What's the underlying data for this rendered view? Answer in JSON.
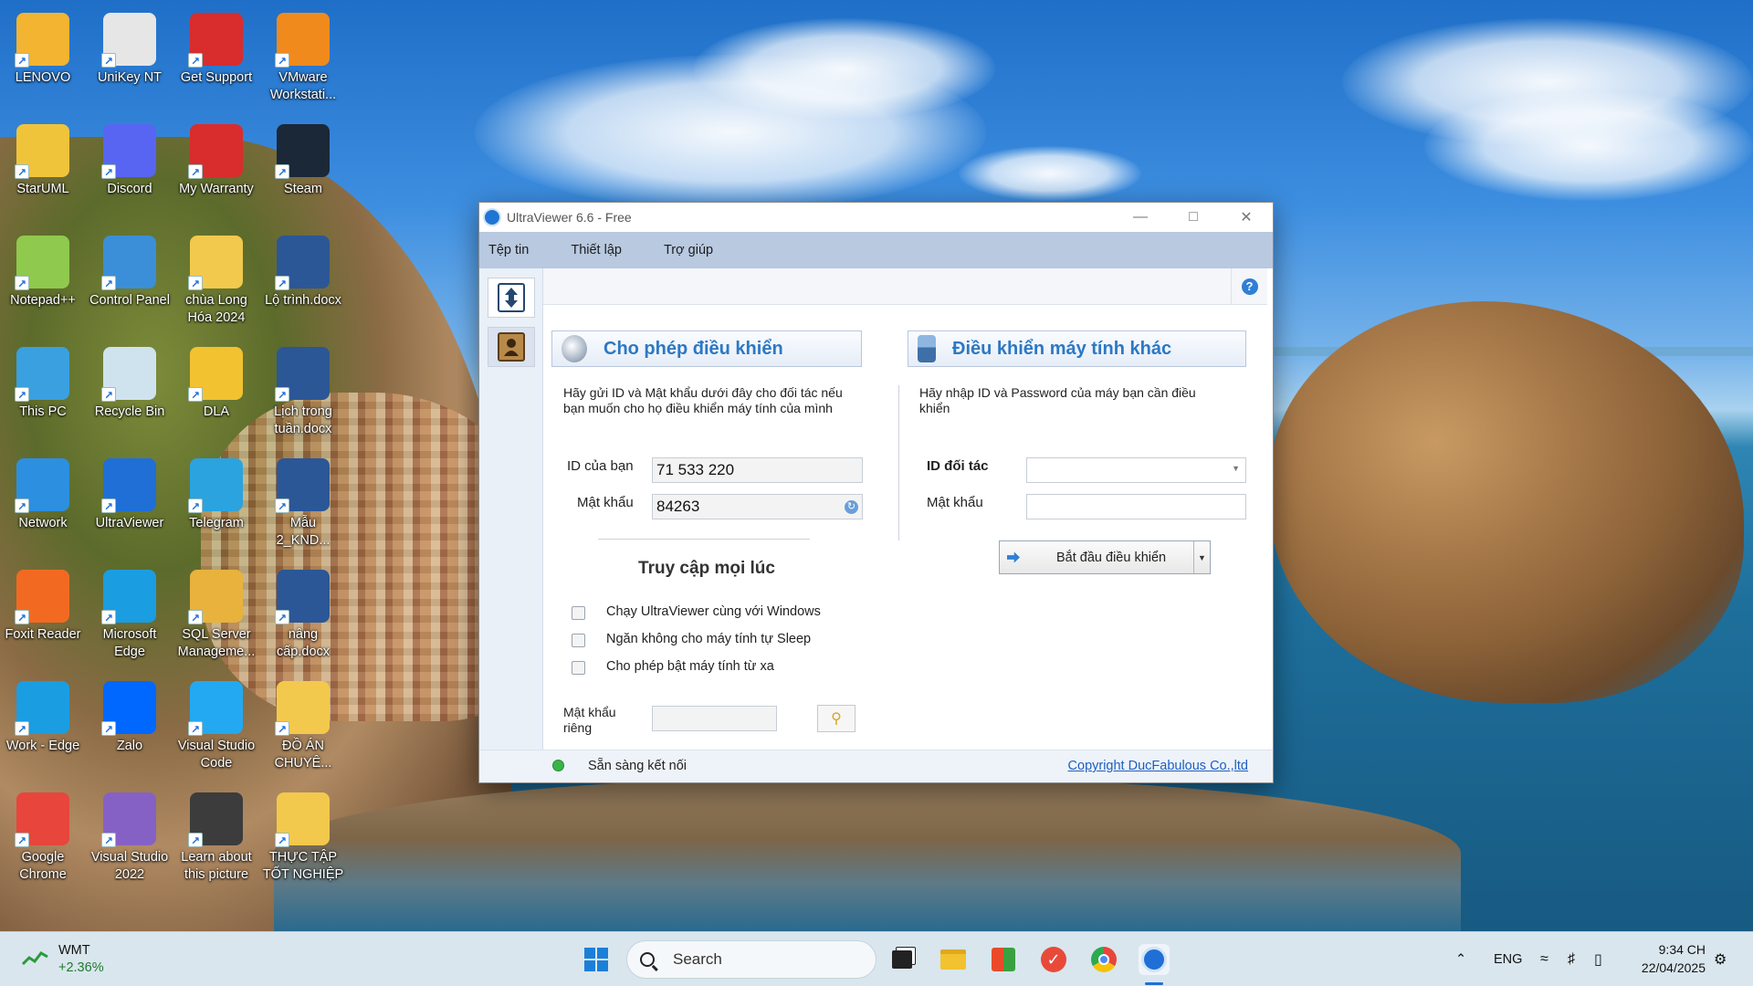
{
  "desktop": {
    "icons": [
      {
        "label": "LENOVO",
        "icon": "folder-user-icon",
        "color": "#f2b431"
      },
      {
        "label": "UniKey NT",
        "icon": "unikey-icon",
        "color": "#e6e6e6"
      },
      {
        "label": "Get Support",
        "icon": "get-support-icon",
        "color": "#d92c2c"
      },
      {
        "label": "VMware Workstati...",
        "icon": "vmware-icon",
        "color": "#f18a1c"
      },
      {
        "label": "StarUML",
        "icon": "staruml-icon",
        "color": "#f0c43a"
      },
      {
        "label": "Discord",
        "icon": "discord-icon",
        "color": "#5865f2"
      },
      {
        "label": "My Warranty",
        "icon": "warranty-icon",
        "color": "#d92c2c"
      },
      {
        "label": "Steam",
        "icon": "steam-icon",
        "color": "#1b2838"
      },
      {
        "label": "Notepad++",
        "icon": "notepadpp-icon",
        "color": "#8fc94d"
      },
      {
        "label": "Control Panel",
        "icon": "control-panel-icon",
        "color": "#3a8fd8"
      },
      {
        "label": "chùa Long Hóa 2024",
        "icon": "folder-icon",
        "color": "#f2c94c"
      },
      {
        "label": "Lộ trình.docx",
        "icon": "word-doc-icon",
        "color": "#2b5797"
      },
      {
        "label": "This PC",
        "icon": "this-pc-icon",
        "color": "#3aa0e0"
      },
      {
        "label": "Recycle Bin",
        "icon": "recycle-bin-icon",
        "color": "#cfe3ef"
      },
      {
        "label": "DLA",
        "icon": "dla-icon",
        "color": "#f2c230"
      },
      {
        "label": "Lịch trong tuần.docx",
        "icon": "word-doc-icon",
        "color": "#2b5797"
      },
      {
        "label": "Network",
        "icon": "network-icon",
        "color": "#2d8fe0"
      },
      {
        "label": "UltraViewer",
        "icon": "ultraviewer-icon",
        "color": "#1f6fd6"
      },
      {
        "label": "Telegram",
        "icon": "telegram-icon",
        "color": "#2aa3df"
      },
      {
        "label": "Mẫu 2_KND...",
        "icon": "word-doc-icon",
        "color": "#2b5797"
      },
      {
        "label": "Foxit Reader",
        "icon": "foxit-icon",
        "color": "#f26a21"
      },
      {
        "label": "Microsoft Edge",
        "icon": "edge-icon",
        "color": "#1b9de2"
      },
      {
        "label": "SQL Server Manageme...",
        "icon": "sql-server-icon",
        "color": "#e8b23c"
      },
      {
        "label": "nâng cấp.docx",
        "icon": "word-doc-icon",
        "color": "#2b5797"
      },
      {
        "label": "Work - Edge",
        "icon": "edge-icon",
        "color": "#1b9de2"
      },
      {
        "label": "Zalo",
        "icon": "zalo-icon",
        "color": "#0068ff"
      },
      {
        "label": "Visual Studio Code",
        "icon": "vscode-icon",
        "color": "#23a9f2"
      },
      {
        "label": "ĐỒ ÁN CHUYÊ...",
        "icon": "folder-icon",
        "color": "#f2c94c"
      },
      {
        "label": "Google Chrome",
        "icon": "chrome-icon",
        "color": "#e8453c"
      },
      {
        "label": "Visual Studio 2022",
        "icon": "visual-studio-icon",
        "color": "#8661c5"
      },
      {
        "label": "Learn about this picture",
        "icon": "learn-picture-icon",
        "color": "#3c3c3c"
      },
      {
        "label": "THỰC TẬP TỐT NGHIỆP",
        "icon": "folder-icon",
        "color": "#f2c94c"
      }
    ]
  },
  "window": {
    "title": "UltraViewer 6.6 - Free",
    "menu": [
      "Tệp tin",
      "Thiết lập",
      "Trợ giúp"
    ],
    "help_label": "?",
    "left_panel": {
      "heading": "Cho phép điều khiển",
      "description": "Hãy gửi ID và Mật khẩu dưới đây cho đối tác nếu bạn muốn cho họ điều khiển máy tính của mình",
      "id_label": "ID của bạn",
      "id_value": "71 533 220",
      "password_label": "Mật khẩu",
      "password_value": "84263",
      "access_heading": "Truy cập mọi lúc",
      "options": [
        "Chạy UltraViewer cùng với Windows",
        "Ngăn không cho máy tính tự Sleep",
        "Cho phép bật máy tính từ xa"
      ],
      "private_password_label": "Mật khẩu riêng",
      "private_password_value": ""
    },
    "right_panel": {
      "heading": "Điều khiển máy tính khác",
      "description": "Hãy nhập ID và Password của máy bạn cần điều khiển",
      "partner_id_label": "ID đối tác",
      "partner_id_value": "",
      "password_label": "Mật khẩu",
      "password_value": "",
      "start_button": "Bắt đầu điều khiển"
    },
    "status": {
      "text": "Sẵn sàng kết nối",
      "copyright": "Copyright DucFabulous Co.,ltd",
      "status_color": "#37b54a"
    }
  },
  "taskbar": {
    "widget": {
      "name": "WMT",
      "change": "+2.36%"
    },
    "search_placeholder": "Search",
    "language": "ENG",
    "time": "9:34 CH",
    "date": "22/04/2025"
  }
}
